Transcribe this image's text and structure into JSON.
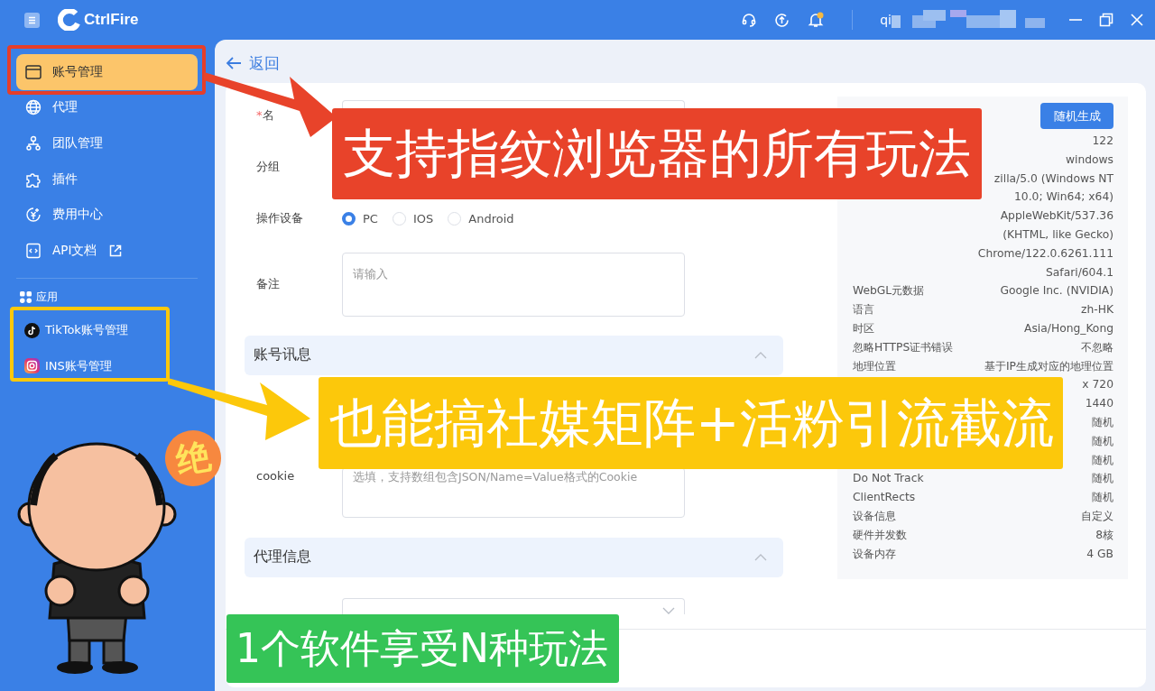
{
  "app": {
    "title": "CtrlFire"
  },
  "header": {
    "username": "qi"
  },
  "sidebar": {
    "items": [
      {
        "label": "账号管理",
        "kind": "window",
        "selected": true
      },
      {
        "label": "代理",
        "kind": "globe",
        "selected": false
      },
      {
        "label": "团队管理",
        "kind": "team",
        "selected": false
      },
      {
        "label": "插件",
        "kind": "puzzle",
        "selected": false
      },
      {
        "label": "费用中心",
        "kind": "coin",
        "selected": false
      },
      {
        "label": "API文档",
        "kind": "api",
        "selected": false,
        "external": true
      }
    ],
    "section": "应用",
    "apps": [
      {
        "label": "TikTok账号管理",
        "kind": "tiktok"
      },
      {
        "label": "INS账号管理",
        "kind": "instagram"
      }
    ]
  },
  "back": "返回",
  "form": {
    "rows": [
      {
        "kind": "text",
        "label": "名",
        "required_mark": "*"
      },
      {
        "kind": "label",
        "label": "分组"
      },
      {
        "kind": "radio",
        "label": "操作设备",
        "options": [
          {
            "label": "PC",
            "selected": true
          },
          {
            "label": "IOS",
            "selected": false
          },
          {
            "label": "Android",
            "selected": false
          }
        ]
      },
      {
        "kind": "textarea",
        "label": "备注",
        "placeholder": "请输入"
      },
      {
        "kind": "section",
        "title": "账号讯息",
        "expanded": true
      },
      {
        "kind": "covered"
      },
      {
        "kind": "textarea",
        "label": "cookie",
        "placeholder": "选填，支持数组包含JSON/Name=Value格式的Cookie"
      },
      {
        "kind": "section",
        "title": "代理信息",
        "expanded": true
      },
      {
        "kind": "select"
      }
    ]
  },
  "fingerprint": {
    "button": "随机生成",
    "rows": [
      {
        "value": "122"
      },
      {
        "value": "windows"
      },
      {
        "value": "zilla/5.0 (Windows NT"
      },
      {
        "value": "10.0; Win64; x64)"
      },
      {
        "value": "AppleWebKit/537.36"
      },
      {
        "value": "(KHTML, like Gecko)"
      },
      {
        "value": "Chrome/122.0.6261.111"
      },
      {
        "value": "Safari/604.1"
      },
      {
        "label": "WebGL元数据",
        "value": "Google Inc. (NVIDIA)"
      },
      {
        "label": "语言",
        "value": "zh-HK"
      },
      {
        "label": "时区",
        "value": "Asia/Hong_Kong"
      },
      {
        "label": "忽略HTTPS证书错误",
        "value": "不忽略"
      },
      {
        "label": "地理位置",
        "value": "基于IP生成对应的地理位置"
      },
      {
        "value": "x 720"
      },
      {
        "value": "1440"
      },
      {
        "value": "随机"
      },
      {
        "value": "随机"
      },
      {
        "value": "随机"
      },
      {
        "label": "Do Not Track",
        "value": "随机"
      },
      {
        "label": "ClientRects",
        "value": "随机"
      },
      {
        "label": "设备信息",
        "value": "自定义"
      },
      {
        "label": "硬件并发数",
        "value": "8核"
      },
      {
        "label": "设备内存",
        "value": "4 GB"
      }
    ]
  },
  "banners": [
    {
      "text": "支持指纹浏览器的所有玩法",
      "color": "#e8432a"
    },
    {
      "text": "也能搞社媒矩阵+活粉引流截流",
      "color": "#fcc80b"
    },
    {
      "text": "1个软件享受N种玩法",
      "color": "#35c457"
    }
  ],
  "sticker": {
    "text": "绝"
  }
}
